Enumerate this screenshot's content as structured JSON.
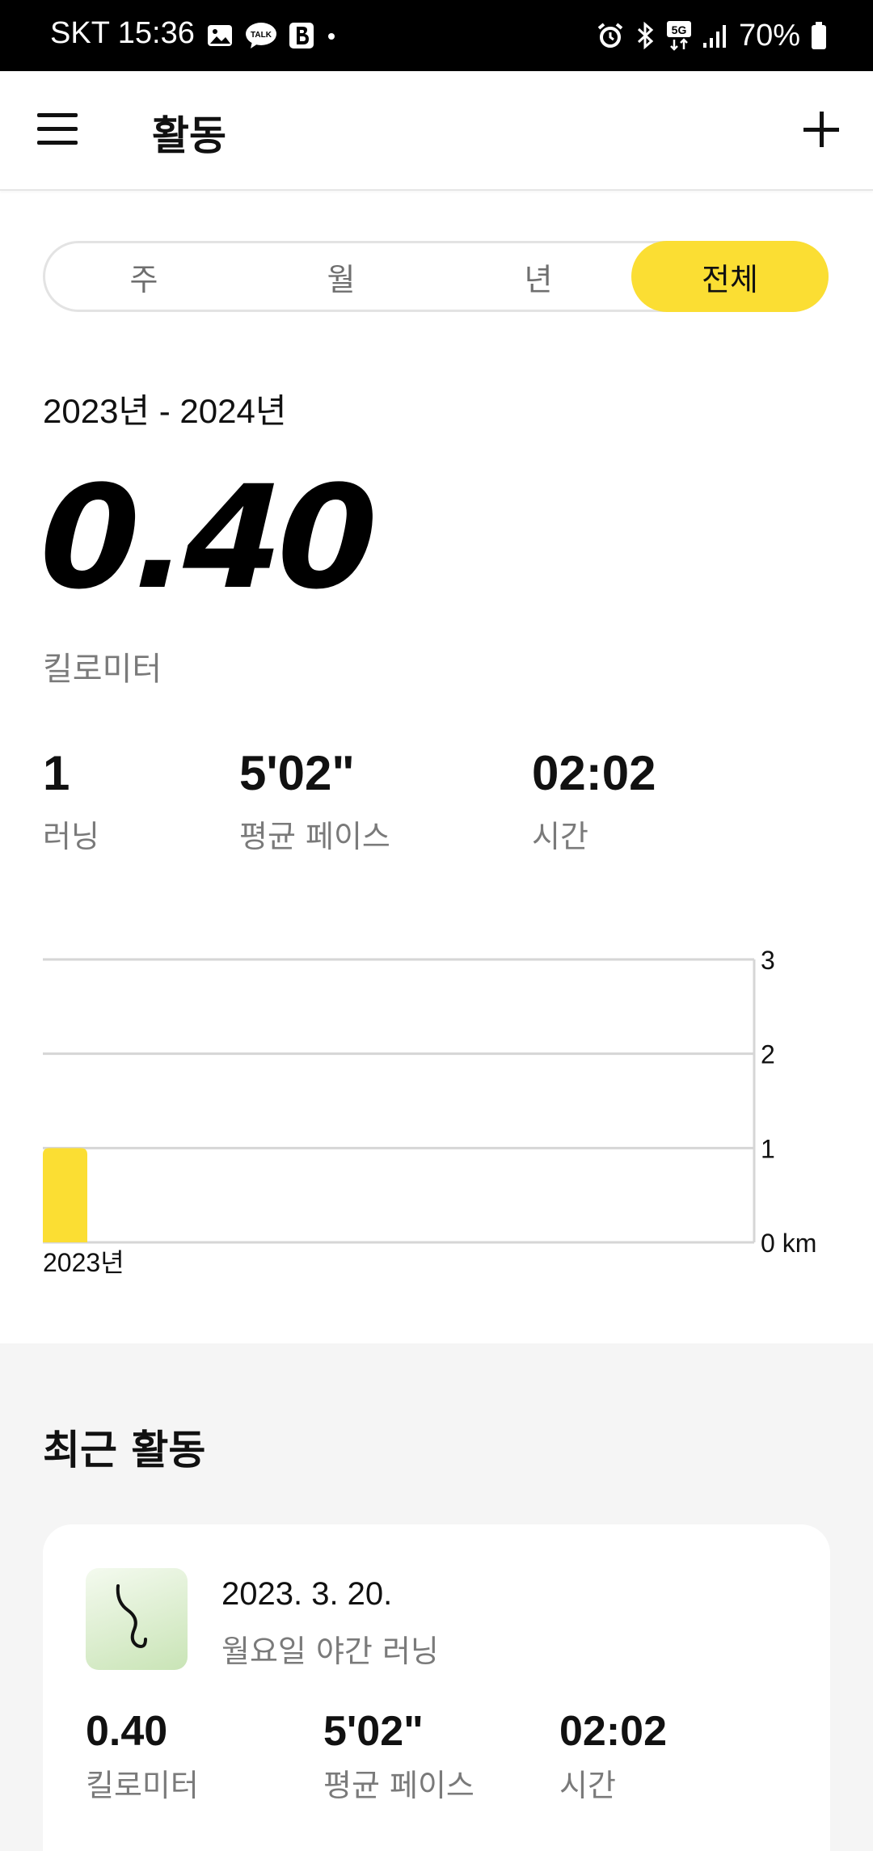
{
  "status_bar": {
    "carrier_time": "SKT 15:36",
    "battery": "70%",
    "left_icons": [
      "gallery-icon",
      "talk-icon",
      "b-icon",
      "dot-icon"
    ],
    "right_icons": [
      "alarm-icon",
      "bluetooth-icon",
      "5g-icon",
      "signal-icon",
      "battery-icon"
    ]
  },
  "header": {
    "title": "활동"
  },
  "tabs": [
    {
      "label": "주",
      "active": false
    },
    {
      "label": "월",
      "active": false
    },
    {
      "label": "년",
      "active": false
    },
    {
      "label": "전체",
      "active": true
    }
  ],
  "summary": {
    "range": "2023년 - 2024년",
    "distance": "0.40",
    "distance_unit": "킬로미터",
    "stats": [
      {
        "value": "1",
        "label": "러닝"
      },
      {
        "value": "5'02\"",
        "label": "평균 페이스"
      },
      {
        "value": "02:02",
        "label": "시간"
      }
    ]
  },
  "chart_data": {
    "type": "bar",
    "categories": [
      "2023년"
    ],
    "values": [
      0.4
    ],
    "ylim": [
      0,
      3
    ],
    "yticks": [
      "0 km",
      "1",
      "2",
      "3"
    ],
    "grid": true,
    "bar_color": "#fbde33"
  },
  "recent": {
    "title": "최근 활동",
    "activities": [
      {
        "date": "2023. 3. 20.",
        "name": "월요일 야간 러닝",
        "stats": [
          {
            "value": "0.40",
            "label": "킬로미터"
          },
          {
            "value": "5'02\"",
            "label": "평균 페이스"
          },
          {
            "value": "02:02",
            "label": "시간"
          }
        ]
      }
    ]
  },
  "colors": {
    "accent": "#fbde33",
    "muted": "#7a7a7a",
    "section_bg": "#f5f5f5"
  }
}
